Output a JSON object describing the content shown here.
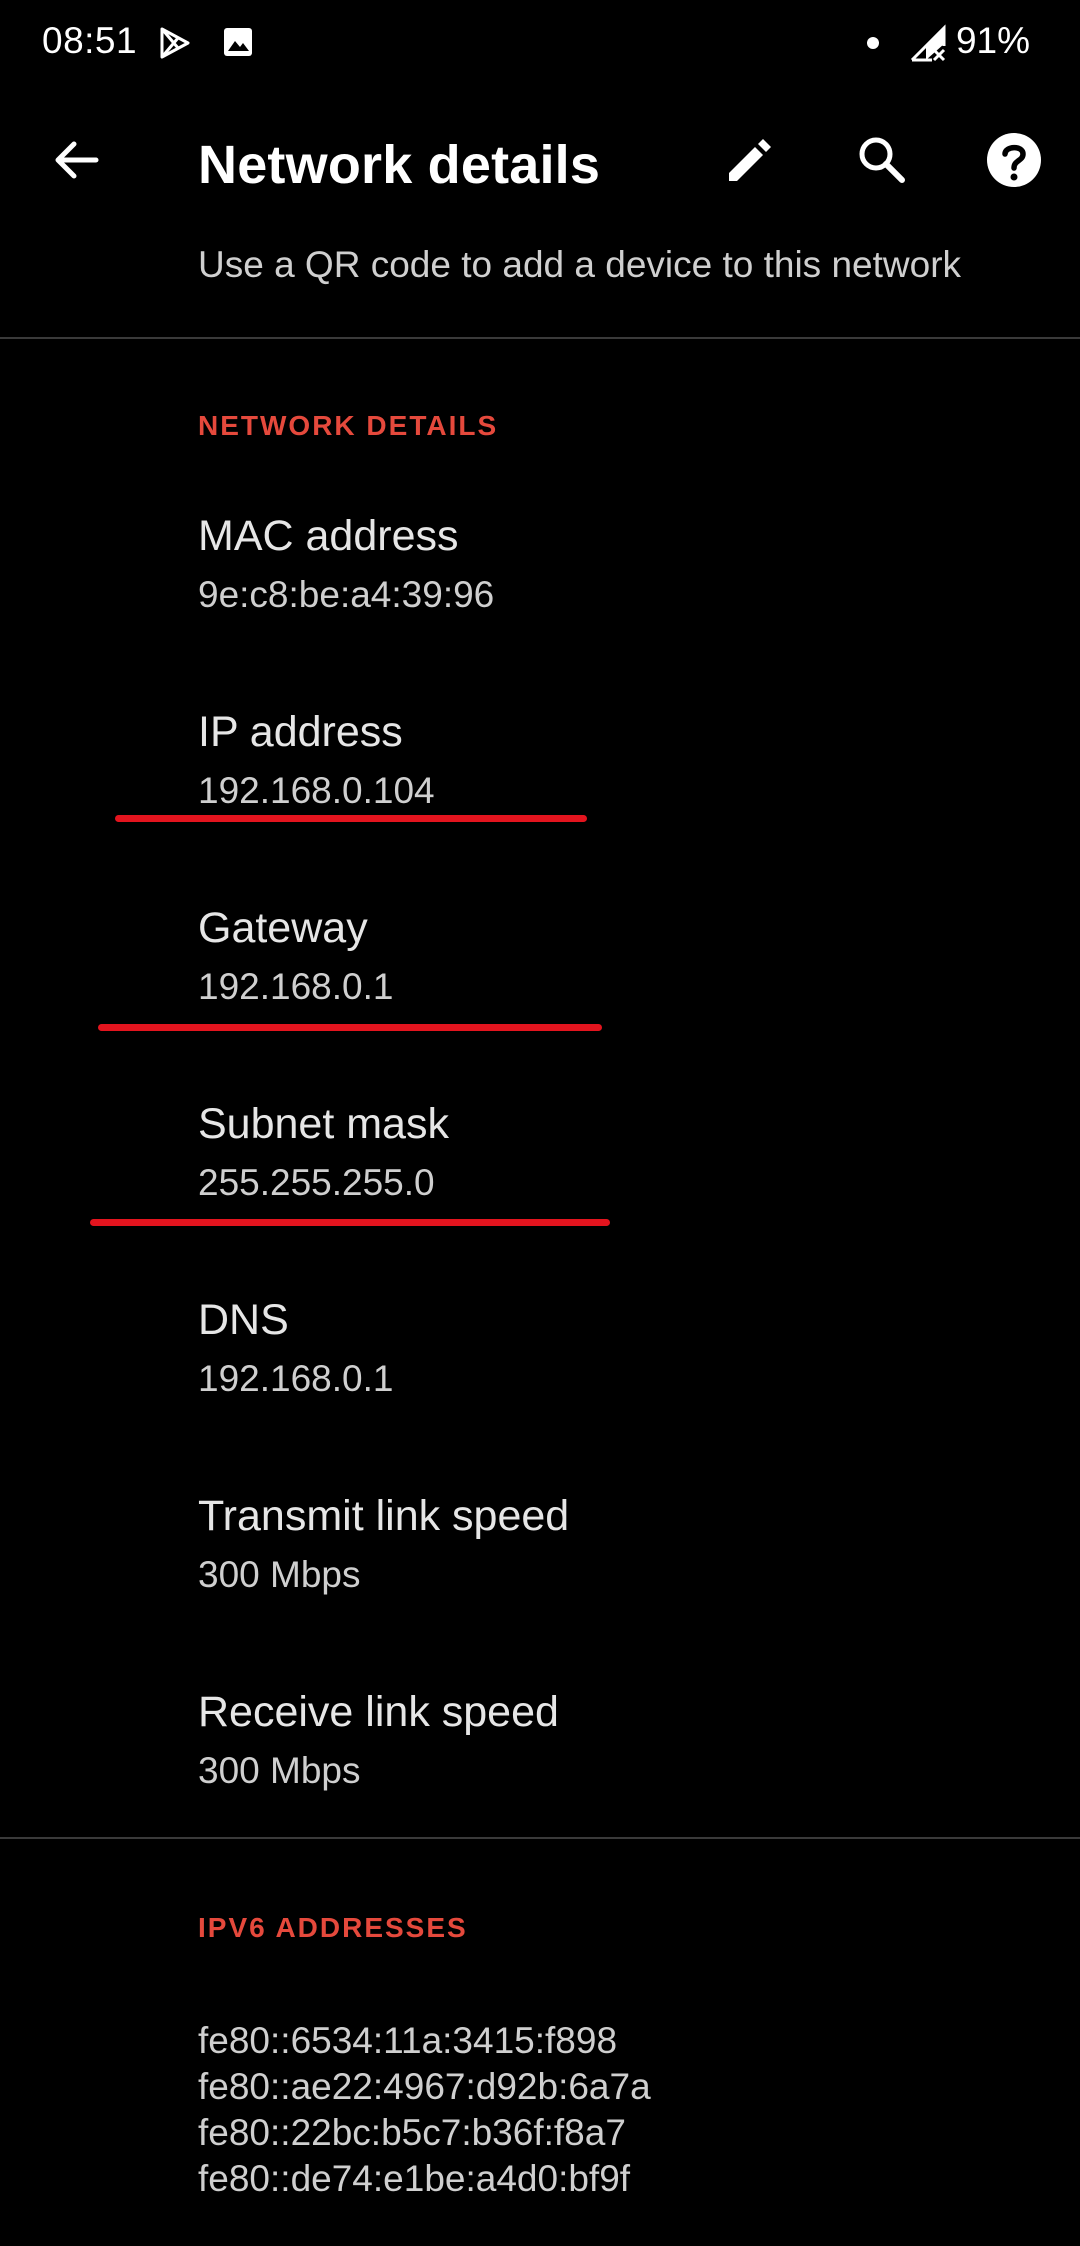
{
  "status_bar": {
    "time": "08:51",
    "icons": [
      "play-store-icon",
      "image-icon",
      "notification-dot-icon",
      "signal-off-icon"
    ],
    "battery": "91%"
  },
  "app_bar": {
    "title": "Network details",
    "actions": [
      "back-arrow-icon",
      "edit-pencil-icon",
      "search-icon",
      "help-icon"
    ]
  },
  "qr": {
    "label": "Use a QR code to add a device to this network"
  },
  "network_details": {
    "header": "NETWORK DETAILS",
    "items": [
      {
        "title": "MAC address",
        "value": "9e:c8:be:a4:39:96"
      },
      {
        "title": "IP address",
        "value": "192.168.0.104"
      },
      {
        "title": "Gateway",
        "value": "192.168.0.1"
      },
      {
        "title": "Subnet mask",
        "value": "255.255.255.0"
      },
      {
        "title": "DNS",
        "value": "192.168.0.1"
      },
      {
        "title": "Transmit link speed",
        "value": "300 Mbps"
      },
      {
        "title": "Receive link speed",
        "value": "300 Mbps"
      }
    ]
  },
  "ipv6": {
    "header": "IPV6 ADDRESSES",
    "addresses": [
      "fe80::6534:11a:3415:f898",
      "fe80::ae22:4967:d92b:6a7a",
      "fe80::22bc:b5c7:b36f:f8a7",
      "fe80::de74:e1be:a4d0:bf9f"
    ]
  },
  "colors": {
    "background": "#000000",
    "accent": "#e5493c",
    "annotation": "#e3141e"
  }
}
